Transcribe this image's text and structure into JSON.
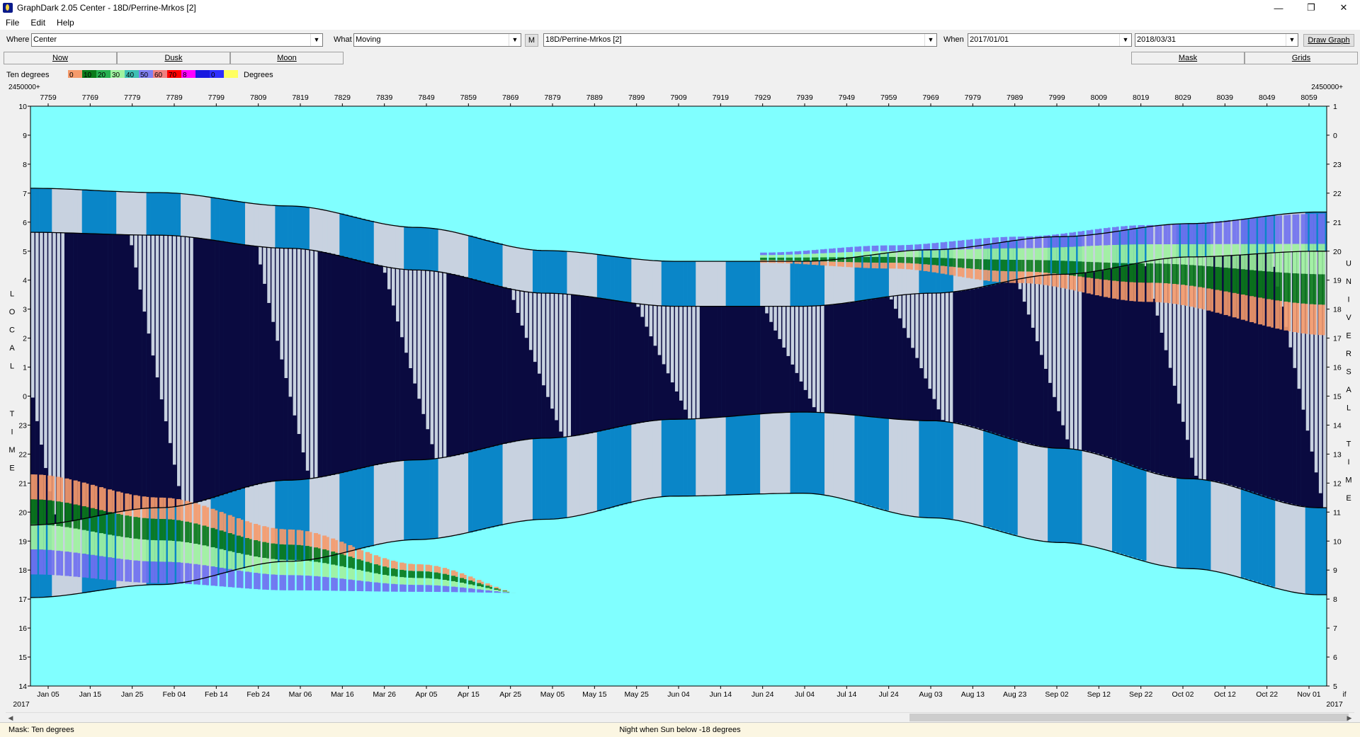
{
  "window": {
    "title": "GraphDark 2.05  Center  -  18D/Perrine-Mrkos [2]",
    "minimize": "—",
    "restore": "❐",
    "close": "✕"
  },
  "menu": [
    "File",
    "Edit",
    "Help"
  ],
  "toolbar": {
    "where_label": "Where",
    "where_value": "Center",
    "what_label": "What",
    "what_value": "Moving",
    "m_button": "M",
    "object_value": "18D/Perrine-Mrkos [2]",
    "when_label": "When",
    "start_date": "2017/01/01",
    "end_date": "2018/03/31",
    "draw_button": "Draw Graph",
    "dropdown_icon": "chevron-down-icon"
  },
  "tabs": {
    "now": "Now",
    "dusk": "Dusk",
    "moon": "Moon",
    "mask": "Mask",
    "grids": "Grids"
  },
  "legend": {
    "label": "Ten degrees",
    "units": "Degrees",
    "bins": [
      {
        "text": "0",
        "color": "#f59a6b"
      },
      {
        "text": "10",
        "color": "#0a7a1a"
      },
      {
        "text": "20",
        "color": "#27b050"
      },
      {
        "text": "30",
        "color": "#9ff29f"
      },
      {
        "text": "40",
        "color": "#3fc0b4"
      },
      {
        "text": "50",
        "color": "#8080f0"
      },
      {
        "text": "60",
        "color": "#f08080"
      },
      {
        "text": "70",
        "color": "#ff0000"
      },
      {
        "text": "8",
        "color": "#ff00ff"
      },
      {
        "text": "",
        "color": "#1818e0"
      },
      {
        "text": "0",
        "color": "#3030ff"
      },
      {
        "text": "",
        "color": "#ffff60"
      }
    ]
  },
  "colors": {
    "sky": "#80ffff",
    "night": "#0a0a40",
    "moonlit": "#c8d2e0",
    "twilight_block": "#0a86c8",
    "low_alt": "#f59a6b",
    "mid_alt": "#0a7a1a",
    "high_alt": "#9ff29f",
    "very_high": "#7070f0"
  },
  "chart_data": {
    "type": "area",
    "jd_label": "2450000+",
    "jd_ticks": [
      "7759",
      "7769",
      "7779",
      "7789",
      "7799",
      "7809",
      "7819",
      "7829",
      "7839",
      "7849",
      "7859",
      "7869",
      "7879",
      "7889",
      "7899",
      "7909",
      "7919",
      "7929",
      "7939",
      "7949",
      "7959",
      "7969",
      "7979",
      "7989",
      "7999",
      "8009",
      "8019",
      "8029",
      "8039",
      "8049",
      "8059"
    ],
    "date_ticks": [
      "Jan 05",
      "Jan 15",
      "Jan 25",
      "Feb 04",
      "Feb 14",
      "Feb 24",
      "Mar 06",
      "Mar 16",
      "Mar 26",
      "Apr 05",
      "Apr 15",
      "Apr 25",
      "May 05",
      "May 15",
      "May 25",
      "Jun 04",
      "Jun 14",
      "Jun 24",
      "Jul 04",
      "Jul 14",
      "Jul 24",
      "Aug 03",
      "Aug 13",
      "Aug 23",
      "Sep 02",
      "Sep 12",
      "Sep 22",
      "Oct 02",
      "Oct 12",
      "Oct 22",
      "Nov 01"
    ],
    "year_left": "2017",
    "year_right": "2017",
    "right_corner_label": "if",
    "left_axis_label": "LOCAL TIME",
    "right_axis_label": "UNIVERSAL TIME",
    "left_ticks": [
      "10",
      "9",
      "8",
      "7",
      "6",
      "5",
      "4",
      "3",
      "2",
      "1",
      "0",
      "23",
      "22",
      "21",
      "20",
      "19",
      "18",
      "17",
      "16",
      "15",
      "14"
    ],
    "right_ticks": [
      "1",
      "0",
      "23",
      "22",
      "21",
      "20",
      "19",
      "18",
      "17",
      "16",
      "15",
      "14",
      "13",
      "12",
      "11",
      "10",
      "9",
      "8",
      "7",
      "6",
      "5"
    ],
    "ylim": [
      -10,
      10
    ],
    "sample_days": [
      0,
      30,
      60,
      90,
      120,
      150,
      180,
      210,
      240,
      270,
      300
    ],
    "dawn_begin_hours": [
      7.17,
      7.02,
      6.56,
      5.82,
      5.02,
      4.65,
      4.65,
      5.05,
      5.5,
      5.95,
      6.35
    ],
    "dawn_end_hours": [
      5.65,
      5.55,
      5.1,
      4.35,
      3.55,
      3.1,
      3.1,
      3.55,
      4.2,
      4.8,
      5.0
    ],
    "dusk_begin_hours": [
      -4.45,
      -3.85,
      -2.9,
      -2.2,
      -1.45,
      -0.8,
      -0.55,
      -0.85,
      -1.8,
      -2.85,
      -3.85
    ],
    "dusk_end_hours": [
      -6.95,
      -6.5,
      -5.7,
      -4.95,
      -4.25,
      -3.45,
      -3.35,
      -4.2,
      -5.05,
      -5.95,
      -6.85
    ],
    "object_rise_hours": [
      -2.7,
      -3.5,
      -4.6,
      -5.8,
      -7.0,
      -8.5
    ],
    "object_set_hours": [
      -6.15,
      -6.45,
      -6.7,
      -6.75,
      -6.8,
      -6.9
    ],
    "object_late_rise_hours": [
      4.6,
      4.4,
      3.9,
      3.25,
      2.1
    ],
    "object_late_set_hours": [
      4.95,
      5.2,
      5.5,
      5.9,
      6.3
    ],
    "moon_cycle_days": 29.53
  },
  "status": {
    "mask": "Mask:  Ten degrees",
    "night": "Night when Sun below -18 degrees"
  }
}
